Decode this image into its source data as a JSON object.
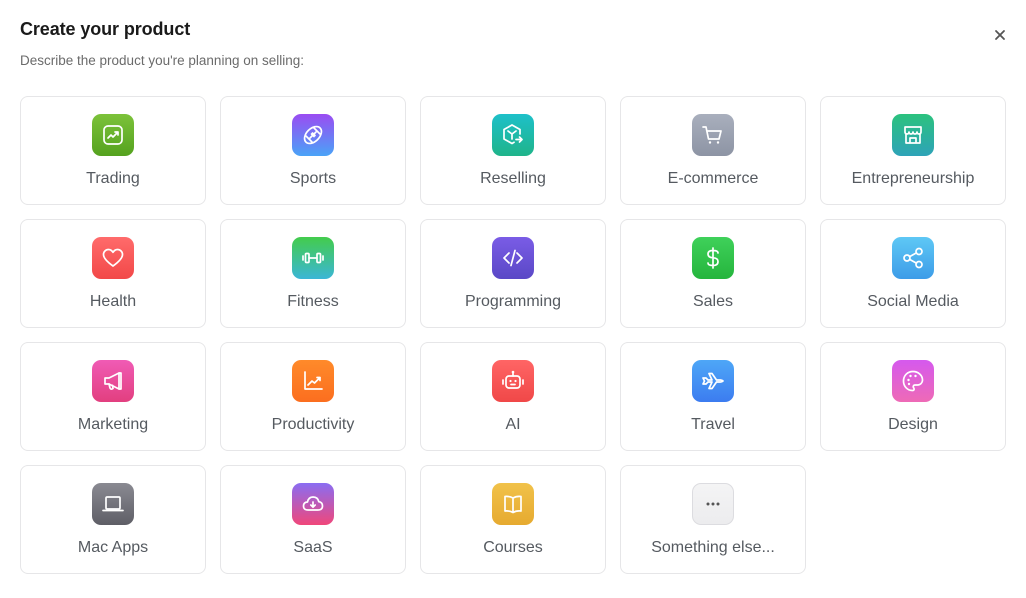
{
  "dialog": {
    "title": "Create your product",
    "subtitle": "Describe the product you're planning on selling:",
    "close_icon": "close-icon"
  },
  "categories": [
    {
      "label": "Trading",
      "icon": "trending-chart-icon",
      "gradient": [
        "#7cc23a",
        "#55a21f"
      ]
    },
    {
      "label": "Sports",
      "icon": "football-icon",
      "gradient": [
        "#9a4cf2",
        "#4aa3f7"
      ]
    },
    {
      "label": "Reselling",
      "icon": "box-arrow-icon",
      "gradient": [
        "#1ec0c9",
        "#1fb48a"
      ]
    },
    {
      "label": "E-commerce",
      "icon": "shopping-cart-icon",
      "gradient": [
        "#a9afbd",
        "#8d94a4"
      ]
    },
    {
      "label": "Entrepreneurship",
      "icon": "storefront-icon",
      "gradient": [
        "#2bc27e",
        "#2ea3b8"
      ]
    },
    {
      "label": "Health",
      "icon": "heart-icon",
      "gradient": [
        "#ff6b6b",
        "#f24848"
      ]
    },
    {
      "label": "Fitness",
      "icon": "dumbbell-icon",
      "gradient": [
        "#43cc4c",
        "#3bb6d6"
      ]
    },
    {
      "label": "Programming",
      "icon": "code-icon",
      "gradient": [
        "#7a5ce6",
        "#5a48c6"
      ]
    },
    {
      "label": "Sales",
      "icon": "dollar-icon",
      "gradient": [
        "#3fd15a",
        "#25b53d"
      ]
    },
    {
      "label": "Social Media",
      "icon": "share-icon",
      "gradient": [
        "#5ec8f5",
        "#3d9ce8"
      ]
    },
    {
      "label": "Marketing",
      "icon": "megaphone-icon",
      "gradient": [
        "#f05bb5",
        "#e23f7f"
      ]
    },
    {
      "label": "Productivity",
      "icon": "growth-chart-icon",
      "gradient": [
        "#ff8a2a",
        "#fb6e1f"
      ]
    },
    {
      "label": "AI",
      "icon": "robot-icon",
      "gradient": [
        "#ff6565",
        "#f04848"
      ]
    },
    {
      "label": "Travel",
      "icon": "airplane-icon",
      "gradient": [
        "#4ea7f7",
        "#3c7cf0"
      ]
    },
    {
      "label": "Design",
      "icon": "palette-icon",
      "gradient": [
        "#d559ee",
        "#ee6ab6"
      ]
    },
    {
      "label": "Mac Apps",
      "icon": "laptop-icon",
      "gradient": [
        "#8a8a92",
        "#5e5e66"
      ]
    },
    {
      "label": "SaaS",
      "icon": "cloud-download-icon",
      "gradient": [
        "#8a6df2",
        "#f0477a"
      ]
    },
    {
      "label": "Courses",
      "icon": "book-icon",
      "gradient": [
        "#f1c24a",
        "#e6aa30"
      ]
    },
    {
      "label": "Something else...",
      "icon": "more-icon",
      "gradient": [
        "#f4f4f5",
        "#ececee"
      ]
    }
  ]
}
